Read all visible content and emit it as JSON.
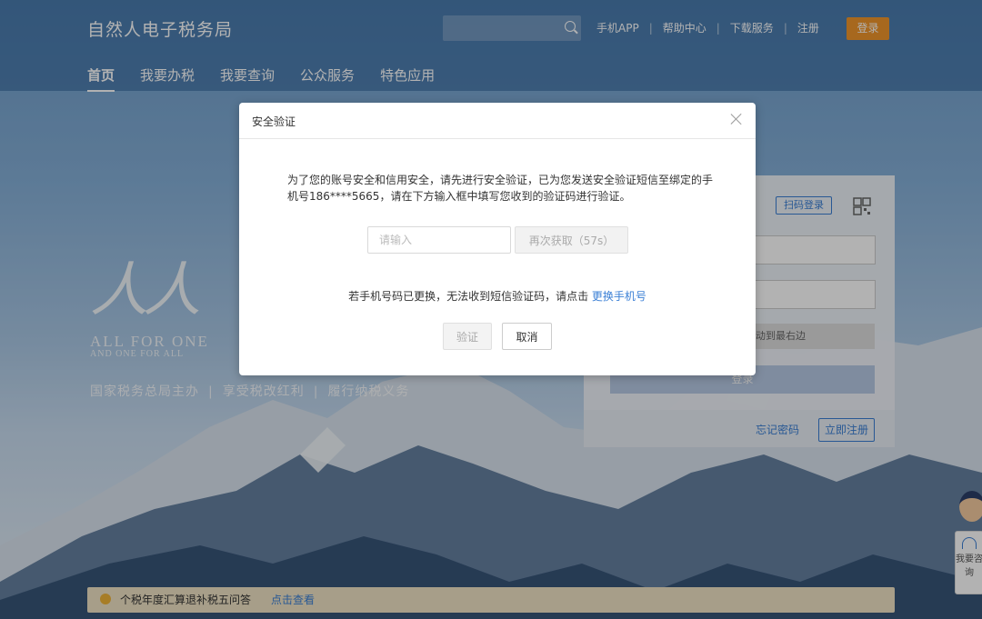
{
  "header": {
    "site_title": "自然人电子税务局",
    "links": [
      "手机APP",
      "帮助中心",
      "下载服务",
      "注册"
    ],
    "login_label": "登录",
    "nav": [
      "首页",
      "我要办税",
      "我要查询",
      "公众服务",
      "特色应用"
    ]
  },
  "hero": {
    "big_text": "人人",
    "slogan_en1": "ALL FOR ONE",
    "slogan_en2": "AND ONE FOR ALL",
    "slogan_cn": [
      "国家税务总局主办",
      "享受税改红利",
      "履行纳税义务"
    ]
  },
  "login_panel": {
    "scan_label": "扫码登录",
    "slider_text": "动到最右边",
    "submit_label": "登录",
    "forgot_label": "忘记密码",
    "register_label": "立即注册"
  },
  "modal": {
    "title": "安全验证",
    "message": "为了您的账号安全和信用安全，请先进行安全验证，已为您发送安全验证短信至绑定的手机号186****5665，请在下方输入框中填写您收到的验证码进行验证。",
    "code_placeholder": "请输入",
    "resend_label": "再次获取（57s）",
    "change_phone_text": "若手机号码已更换，无法收到短信验证码，请点击",
    "change_phone_link": "更换手机号",
    "verify_label": "验证",
    "cancel_label": "取消"
  },
  "notice": {
    "text": "个税年度汇算退补税五问答",
    "link": "点击查看"
  },
  "assistant": {
    "label": "我要咨询"
  }
}
